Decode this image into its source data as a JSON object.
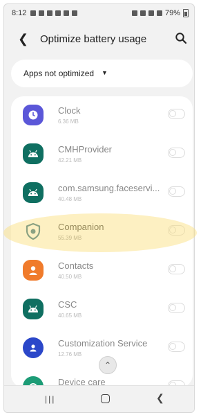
{
  "status_bar": {
    "time": "8:12",
    "battery": "79%"
  },
  "header": {
    "title": "Optimize battery usage"
  },
  "filter": {
    "label": "Apps not optimized"
  },
  "apps": [
    {
      "name": "Clock",
      "size": "6.36 MB",
      "icon": "clock-icon",
      "color": "#5b57d8"
    },
    {
      "name": "CMHProvider",
      "size": "42.21 MB",
      "icon": "android-icon",
      "color": "#0f6f61"
    },
    {
      "name": "com.samsung.faceservi...",
      "size": "40.48 MB",
      "icon": "android-icon",
      "color": "#0f6f61"
    },
    {
      "name": "Companion",
      "size": "55.39 MB",
      "icon": "companion-shield-icon",
      "color": "#2f6f8a"
    },
    {
      "name": "Contacts",
      "size": "40.50 MB",
      "icon": "contacts-icon",
      "color": "#f07b2b"
    },
    {
      "name": "CSC",
      "size": "40.65 MB",
      "icon": "android-icon",
      "color": "#0f6f61"
    },
    {
      "name": "Customization Service",
      "size": "12.76 MB",
      "icon": "customization-icon",
      "color": "#2b47c9"
    },
    {
      "name": "Device care",
      "size": "",
      "icon": "device-care-icon",
      "color": "#1d9c76"
    }
  ]
}
